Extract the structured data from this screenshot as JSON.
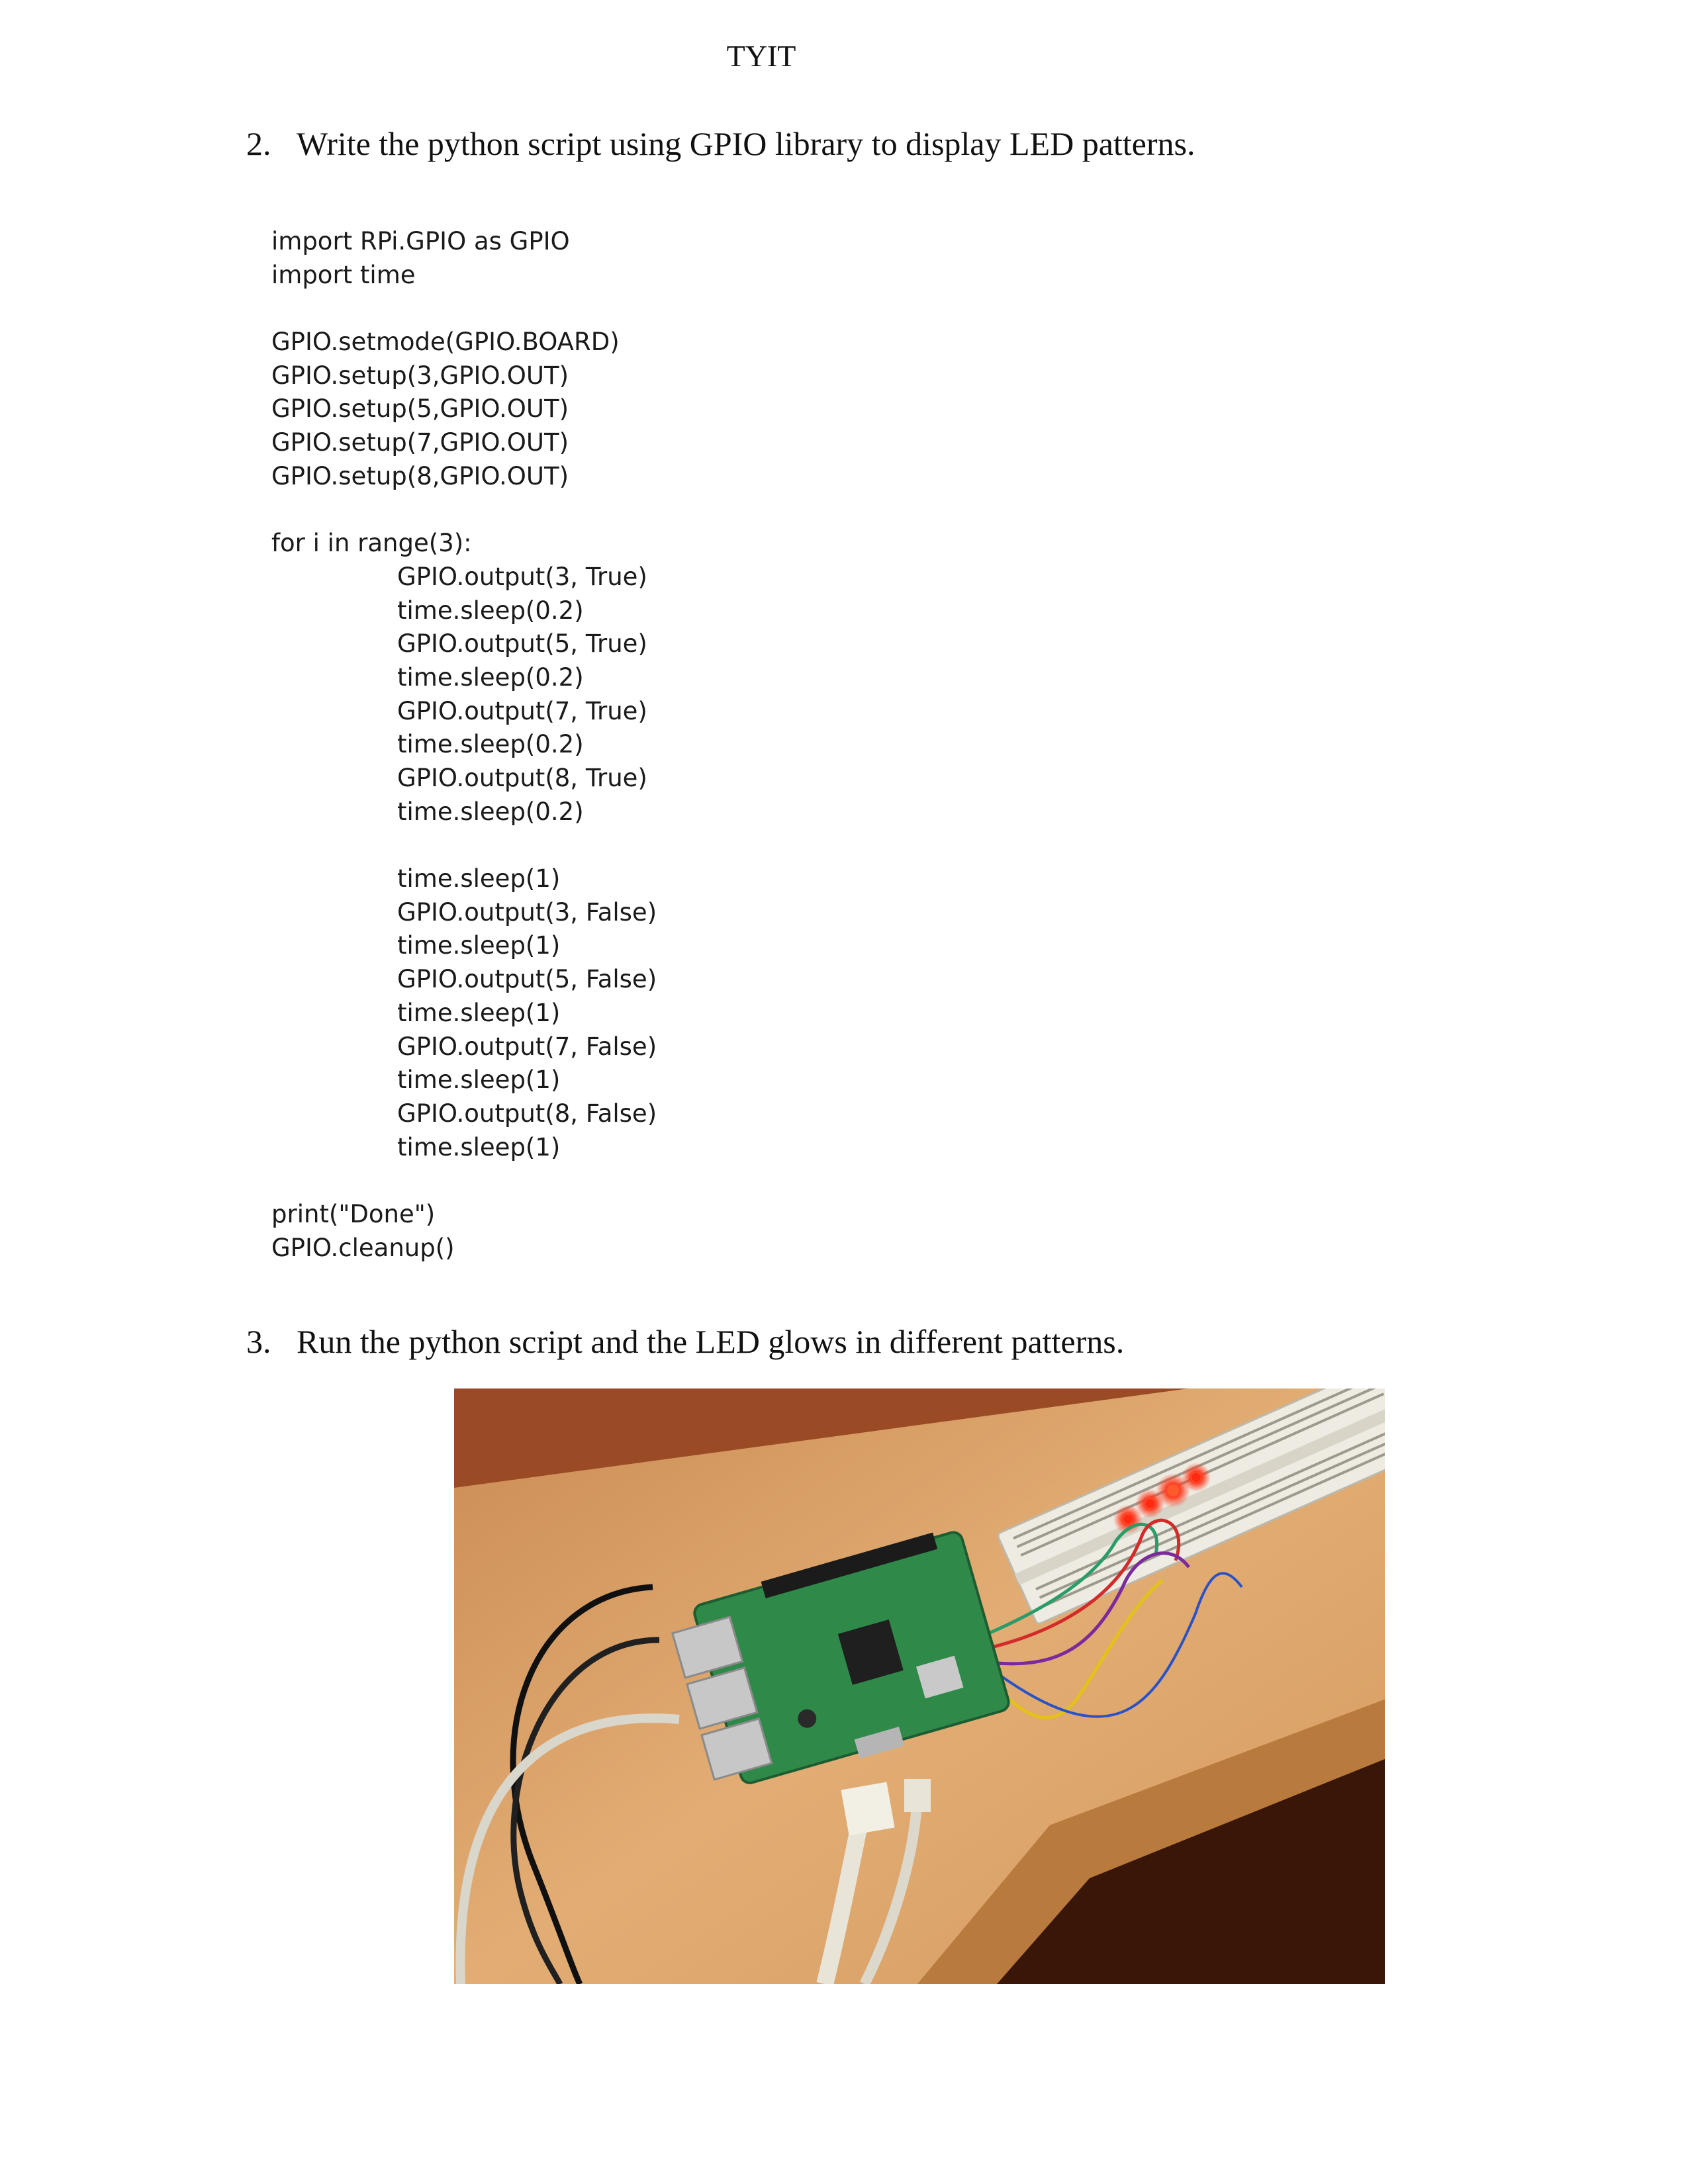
{
  "header": {
    "title": "TYIT"
  },
  "steps": [
    {
      "number": "2.",
      "text": "Write the python script using GPIO library to display LED patterns."
    },
    {
      "number": "3.",
      "text": "Run the python script and the LED glows in different patterns."
    }
  ],
  "code": {
    "lines": [
      "import RPi.GPIO as GPIO",
      "import time",
      "",
      "GPIO.setmode(GPIO.BOARD)",
      "GPIO.setup(3,GPIO.OUT)",
      "GPIO.setup(5,GPIO.OUT)",
      "GPIO.setup(7,GPIO.OUT)",
      "GPIO.setup(8,GPIO.OUT)",
      "",
      "for i in range(3):",
      "GPIO.output(3, True)",
      "time.sleep(0.2)",
      "GPIO.output(5, True)",
      "time.sleep(0.2)",
      "GPIO.output(7, True)",
      "time.sleep(0.2)",
      "GPIO.output(8, True)",
      "time.sleep(0.2)",
      "",
      "time.sleep(1)",
      "GPIO.output(3, False)",
      "time.sleep(1)",
      "GPIO.output(5, False)",
      "time.sleep(1)",
      "GPIO.output(7, False)",
      "time.sleep(1)",
      "GPIO.output(8, False)",
      "time.sleep(1)",
      "",
      "print(\"Done\")",
      "GPIO.cleanup()"
    ]
  },
  "photo": {
    "icon": "raspberry-pi-led-breadboard-photo",
    "colors": {
      "desk": "#d9a066",
      "desk_edge": "#b97a3e",
      "background": "#6a2e14",
      "board": "#2f8a4a",
      "breadboard": "#e9e6dc",
      "led_on": "#ff3b1f"
    }
  }
}
